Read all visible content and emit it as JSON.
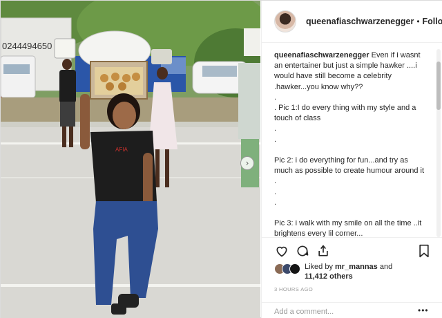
{
  "post": {
    "username": "queenafiaschwarzenegger",
    "separator": "•",
    "follow_label": "Following",
    "caption_username": "queenafiaschwarzenegger",
    "caption_text": " Even if i wasnt an entertainer but just a simple hawker ....i would have still become a celebrity .hawker...you know why??\n.\n. Pic 1:I do every thing with my style and a touch of class\n.\n.\n\nPic 2: i do everything for fun...and try as much as possible to create humour around it\n.\n.\n.\n\nPic 3: i walk with my smile on all the time ..it brightens every lil corner...",
    "liked_by_prefix": "Liked by ",
    "liked_by_user": "mr_mannas",
    "liked_by_and": " and",
    "likes_count": "11,412 others",
    "timestamp": "3 HOURS AGO",
    "comment_placeholder": "Add a comment...",
    "more_label": "•••"
  },
  "photo": {
    "truck_phone_text": "0244494650",
    "shirt_brand_text": "AFIA"
  },
  "icons": {
    "like": "heart-icon",
    "comment": "comment-bubble-icon",
    "share": "share-arrow-icon",
    "save": "bookmark-icon",
    "next": "chevron-right-icon"
  },
  "colors": {
    "text": "#262626",
    "muted": "#999999",
    "border": "#dbdbdb"
  }
}
